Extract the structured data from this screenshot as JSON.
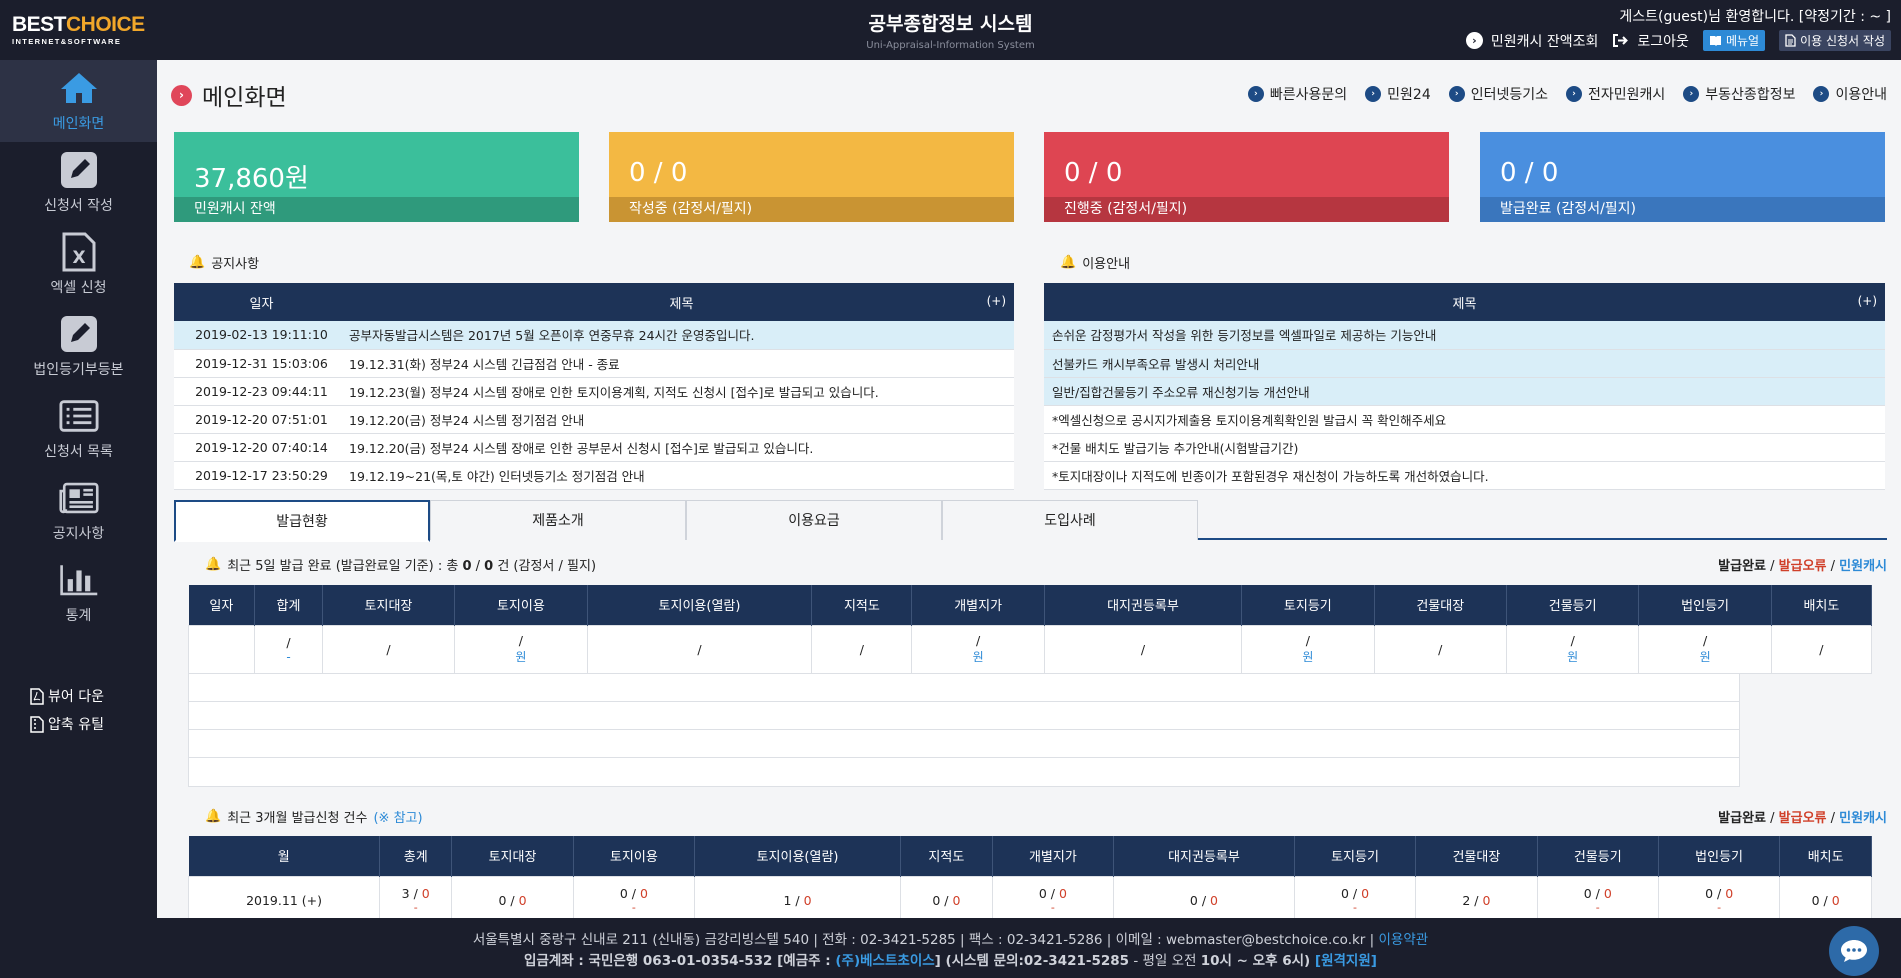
{
  "topbar": {
    "logo_best": "BEST",
    "logo_choice": "CHOICE",
    "logo_sub": "INTERNET&SOFTWARE",
    "title": "공부종합정보 시스템",
    "subtitle": "Uni-Appraisal-Information System",
    "welcome": "게스트(guest)님 환영합니다. [약정기간 : ~ ]",
    "links": {
      "cash": "민원캐시 잔액조회",
      "logout": "로그아웃",
      "manual": "메뉴얼",
      "apply": "이용 신청서 작성"
    }
  },
  "sidebar": {
    "items": [
      {
        "label": "메인화면",
        "icon": "home-icon"
      },
      {
        "label": "신청서 작성",
        "icon": "pencil-icon"
      },
      {
        "label": "엑셀 신청",
        "icon": "excel-icon"
      },
      {
        "label": "법인등기부등본",
        "icon": "pencil-icon"
      },
      {
        "label": "신청서 목록",
        "icon": "list-icon"
      },
      {
        "label": "공지사항",
        "icon": "news-icon"
      },
      {
        "label": "통계",
        "icon": "chart-icon"
      }
    ],
    "downloads": [
      "뷰어 다운",
      "압축 유틸"
    ]
  },
  "page": {
    "title": "메인화면",
    "quicklinks": [
      "빠른사용문의",
      "민원24",
      "인터넷등기소",
      "전자민원캐시",
      "부동산종합정보",
      "이용안내"
    ]
  },
  "cards": [
    {
      "value": "37,860원",
      "label": "민원캐시 잔액",
      "color": "#3bbf9b",
      "dark": "#2f9a7c"
    },
    {
      "value": "0 / 0",
      "label": "작성중 (감정서/필지)",
      "color": "#f3b843",
      "dark": "#c99433"
    },
    {
      "value": "0 / 0",
      "label": "진행중 (감정서/필지)",
      "color": "#de4552",
      "dark": "#b63640"
    },
    {
      "value": "0 / 0",
      "label": "발급완료 (감정서/필지)",
      "color": "#4a8fdf",
      "dark": "#3a76bd"
    }
  ],
  "notice": {
    "title": "공지사항",
    "col_date": "일자",
    "col_title": "제목",
    "more": "(+)",
    "rows": [
      {
        "date": "2019-02-13 19:11:10",
        "title": "공부자동발급시스템은 2017년 5월 오픈이후 연중무휴 24시간 운영중입니다."
      },
      {
        "date": "2019-12-31 15:03:06",
        "title": "19.12.31(화) 정부24 시스템 긴급점검 안내 - 종료"
      },
      {
        "date": "2019-12-23 09:44:11",
        "title": "19.12.23(월) 정부24 시스템 장애로 인한 토지이용계획, 지적도 신청시 [접수]로 발급되고 있습니다."
      },
      {
        "date": "2019-12-20 07:51:01",
        "title": "19.12.20(금) 정부24 시스템 정기점검 안내"
      },
      {
        "date": "2019-12-20 07:40:14",
        "title": "19.12.20(금) 정부24 시스템 장애로 인한 공부문서 신청시 [접수]로 발급되고 있습니다."
      },
      {
        "date": "2019-12-17 23:50:29",
        "title": "19.12.19~21(목,토 야간) 인터넷등기소 정기점검 안내"
      }
    ]
  },
  "guide": {
    "title": "이용안내",
    "col_title": "제목",
    "more": "(+)",
    "rows": [
      "손쉬운 감정평가서 작성을 위한 등기정보를 엑셀파일로 제공하는 기능안내",
      "선불카드 캐시부족오류 발생시 처리안내",
      "일반/집합건물등기 주소오류 재신청기능 개선안내",
      "*엑셀신청으로 공시지가제출용 토지이용계획확인원 발급시 꼭 확인해주세요",
      "*건물 배치도 발급기능 추가안내(시험발급기간)",
      "*토지대장이나 지적도에 빈종이가 포함된경우 재신청이 가능하도록 개선하였습니다."
    ]
  },
  "tabs": [
    "발급현황",
    "제품소개",
    "이용요금",
    "도입사례"
  ],
  "recent5": {
    "title_a": "최근 5일 발급 완료 (발급완료일 기준) : 총 ",
    "total_a": "0",
    "sep": " / ",
    "total_b": "0",
    "title_b": " 건 (감정서 / 필지)",
    "legend": {
      "done": "발급완료",
      "err": "발급오류",
      "cash": "민원캐시",
      "slash": " / "
    },
    "headers": [
      "일자",
      "합계",
      "토지대장",
      "토지이용",
      "토지이용(열람)",
      "지적도",
      "개별지가",
      "대지권등록부",
      "토지등기",
      "건물대장",
      "건물등기",
      "법인등기",
      "배치도"
    ],
    "slash": "/",
    "won": "원",
    "dash": "-"
  },
  "recent3m": {
    "title": "최근 3개월 발급신청 건수",
    "note": "(※ 참고)",
    "headers": [
      "월",
      "총계",
      "토지대장",
      "토지이용",
      "토지이용(열람)",
      "지적도",
      "개별지가",
      "대지권등록부",
      "토지등기",
      "건물대장",
      "건물등기",
      "법인등기",
      "배치도"
    ],
    "row": {
      "month": "2019.11 (+)",
      "cells": [
        {
          "a": "3",
          "b": "0",
          "dash": "-"
        },
        {
          "a": "0",
          "b": "0"
        },
        {
          "a": "0",
          "b": "0",
          "dash": "-"
        },
        {
          "a": "1",
          "b": "0"
        },
        {
          "a": "0",
          "b": "0"
        },
        {
          "a": "0",
          "b": "0",
          "dash": "-"
        },
        {
          "a": "0",
          "b": "0"
        },
        {
          "a": "0",
          "b": "0",
          "dash": "-"
        },
        {
          "a": "2",
          "b": "0"
        },
        {
          "a": "0",
          "b": "0",
          "dash": "-"
        },
        {
          "a": "0",
          "b": "0",
          "dash": "-"
        },
        {
          "a": "0",
          "b": "0"
        }
      ]
    }
  },
  "footer": {
    "line1": "서울특별시 중랑구 신내로 211 (신내동) 금강리빙스텔 540 | 전화 : 02-3421-5285 | 팩스 : 02-3421-5286 | 이메일 : webmaster@bestchoice.co.kr | ",
    "terms": "이용약관",
    "l2a": "입금계좌 : 국민은행 ",
    "l2b": "063-01-0354-532",
    "l2c": " [예금주 : ",
    "l2d": "(주)베스트초이스",
    "l2e": "] (시스템 문의:",
    "l2f": "02-3421-5285",
    "l2g": " - 평일 오전 ",
    "l2h": "10시 ~ 오후 6시",
    "l2i": ") ",
    "l2j": "[원격지원]"
  }
}
